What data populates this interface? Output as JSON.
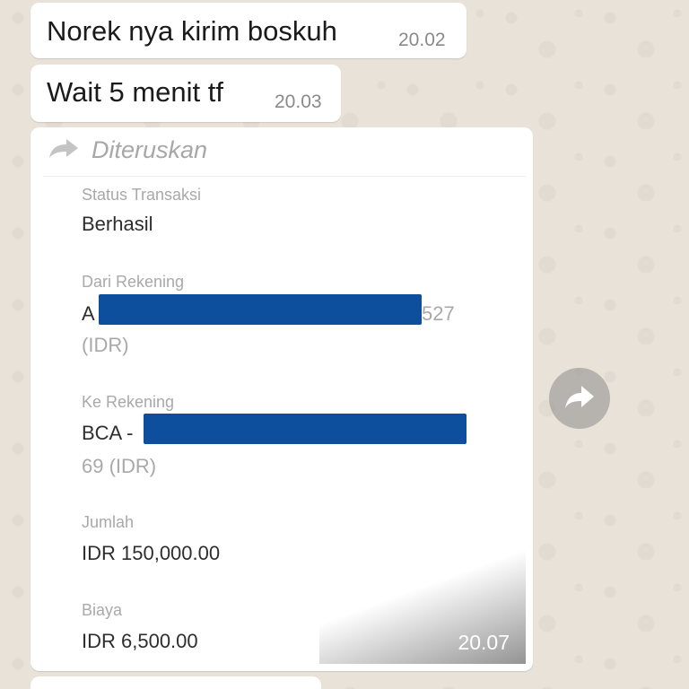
{
  "messages": [
    {
      "text": "Norek nya kirim boskuh",
      "time": "20.02"
    },
    {
      "text": "Wait 5 menit tf",
      "time": "20.03"
    }
  ],
  "forwarded_message": {
    "forwarded_label": "Diteruskan",
    "time": "20.07",
    "receipt": {
      "status_label": "Status Transaksi",
      "status_value": "Berhasil",
      "from_label": "Dari Rekening",
      "from_prefix": "A",
      "from_suffix": "527",
      "from_currency": "(IDR)",
      "to_label": "Ke Rekening",
      "to_prefix": "BCA -",
      "to_sub": "69 (IDR)",
      "amount_label": "Jumlah",
      "amount_value": "IDR 150,000.00",
      "fee_label": "Biaya",
      "fee_value": "IDR 6,500.00"
    }
  },
  "icons": {
    "forward": "forward-arrow-icon",
    "share": "share-forward-icon"
  },
  "colors": {
    "chat_background": "#ece5dd",
    "bubble": "#ffffff",
    "redaction": "#0d4f9c"
  }
}
